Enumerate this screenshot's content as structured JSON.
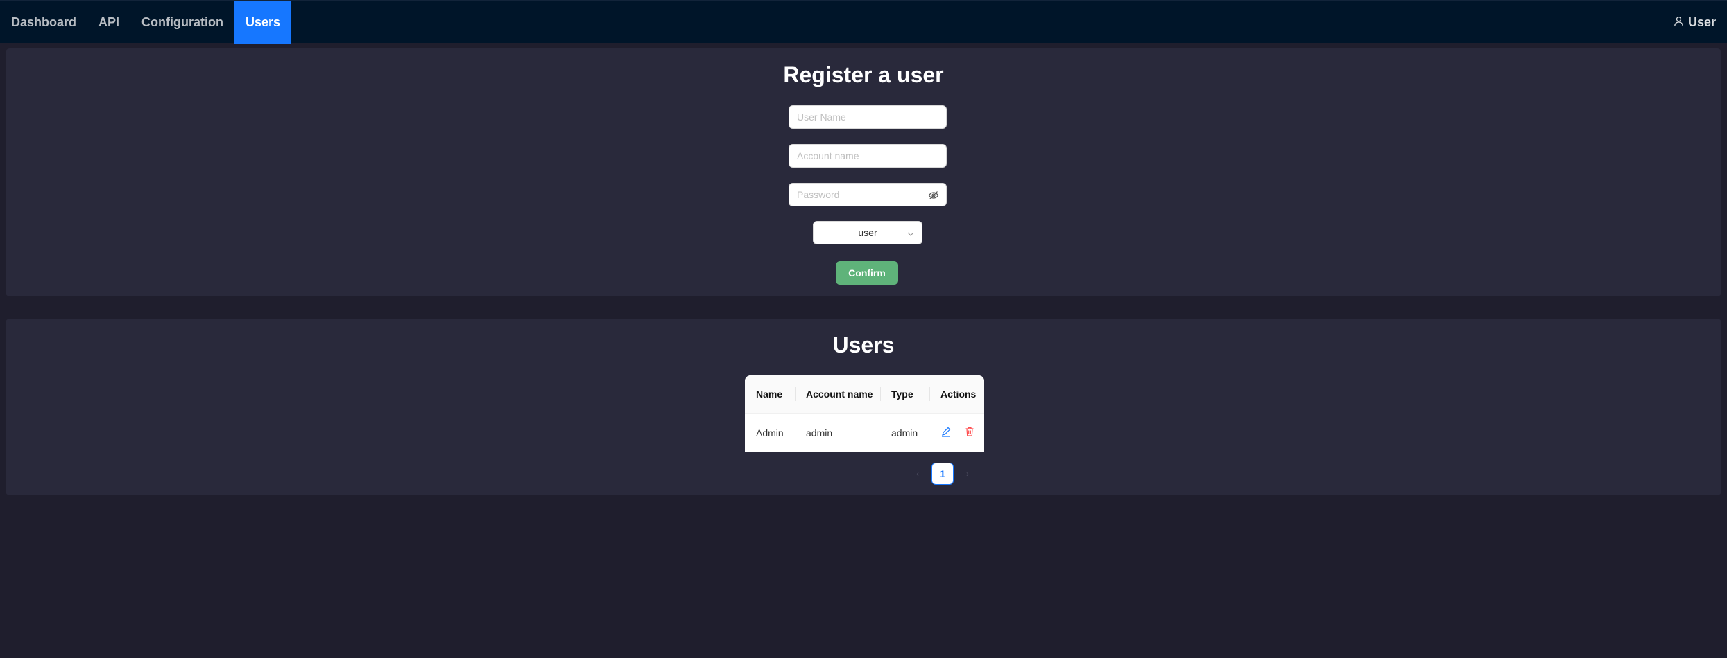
{
  "nav": {
    "items": [
      {
        "label": "Dashboard"
      },
      {
        "label": "API"
      },
      {
        "label": "Configuration"
      },
      {
        "label": "Users"
      }
    ],
    "active": "Users",
    "user_label": "User",
    "icons": {
      "user": "user-icon"
    }
  },
  "register": {
    "title": "Register a user",
    "username_placeholder": "User Name",
    "account_placeholder": "Account name",
    "password_placeholder": "Password",
    "role_value": "user",
    "confirm_label": "Confirm",
    "icons": {
      "password_toggle": "eye-invisible-icon",
      "select_arrow": "chevron-down-icon"
    }
  },
  "users": {
    "title": "Users",
    "columns": [
      "Name",
      "Account name",
      "Type",
      "Actions"
    ],
    "rows": [
      {
        "name": "Admin",
        "account": "admin",
        "type": "admin"
      }
    ],
    "icons": {
      "edit": "edit-icon",
      "delete": "delete-icon"
    },
    "pagination": {
      "current": "1",
      "prev": "‹",
      "next": "›"
    }
  },
  "colors": {
    "accent": "#1677ff",
    "confirm": "#5fb37a",
    "delete": "#ff4d4f",
    "background": "#1f1e2d",
    "card": "#29293b",
    "nav": "#001529"
  }
}
